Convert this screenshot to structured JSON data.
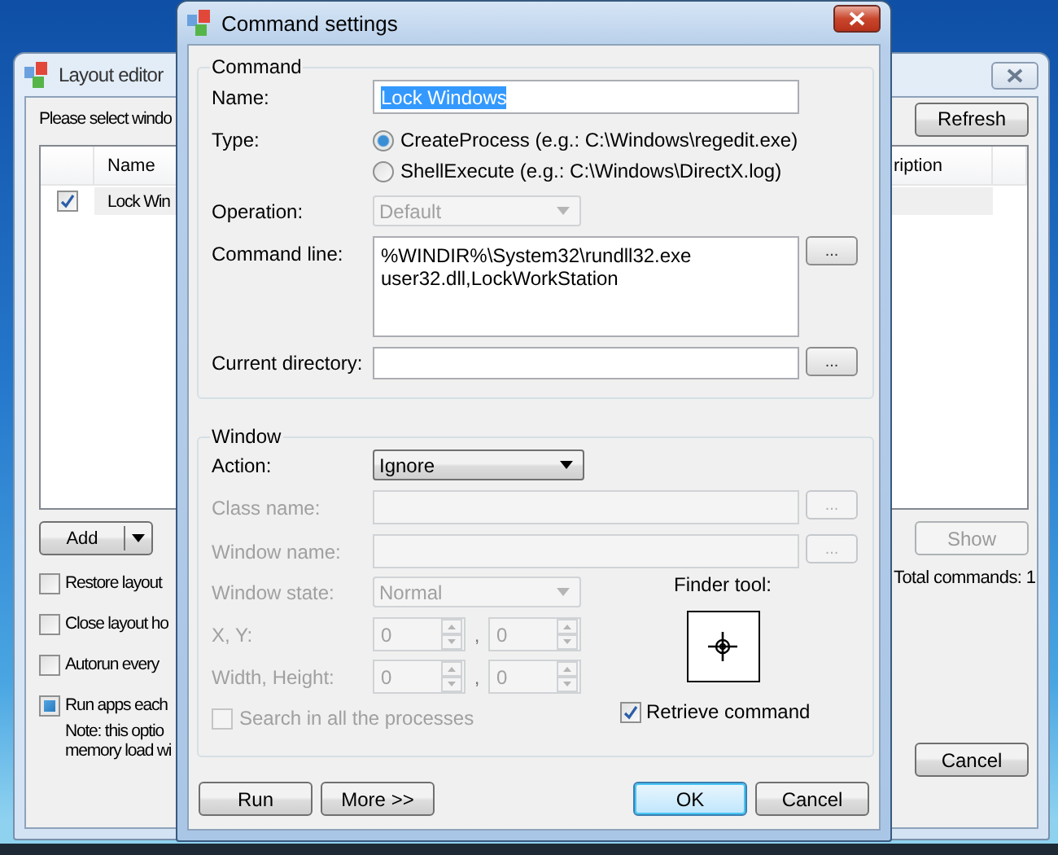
{
  "background_window": {
    "title": "Layout editor",
    "instruction": "Please select windo",
    "refresh_button": "Refresh",
    "list": {
      "columns": [
        "Name",
        "ription"
      ],
      "rows": [
        {
          "checked": true,
          "selected": true,
          "name": "Lock Win"
        }
      ]
    },
    "add_button": "Add",
    "show_button": {
      "label": "Show",
      "disabled": true
    },
    "total_commands": "Total commands: 1",
    "options": [
      {
        "label": "Restore layout",
        "checked": false
      },
      {
        "label": "Close layout ho",
        "checked": false
      },
      {
        "label": "Autorun every",
        "checked": false
      },
      {
        "label": "Run apps each",
        "checked": true
      }
    ],
    "note": [
      "Note: this optio",
      "memory load wi"
    ],
    "cancel_button": "Cancel"
  },
  "dialog": {
    "title": "Command settings",
    "command_group": {
      "title": "Command",
      "name": {
        "label": "Name:",
        "value": "Lock Windows"
      },
      "type": {
        "label": "Type:",
        "options": [
          {
            "label": "CreateProcess (e.g.: C:\\Windows\\regedit.exe)",
            "selected": true
          },
          {
            "label": "ShellExecute (e.g.: C:\\Windows\\DirectX.log)",
            "selected": false
          }
        ]
      },
      "operation": {
        "label": "Operation:",
        "value": "Default",
        "disabled": true
      },
      "command_line": {
        "label": "Command line:",
        "value": "%WINDIR%\\System32\\rundll32.exe user32.dll,LockWorkStation",
        "browse": "..."
      },
      "current_directory": {
        "label": "Current directory:",
        "browse": "..."
      }
    },
    "window_group": {
      "title": "Window",
      "action": {
        "label": "Action:",
        "value": "Ignore"
      },
      "class_name": {
        "label": "Class name:",
        "browse": "...",
        "disabled": true
      },
      "window_name": {
        "label": "Window name:",
        "browse": "...",
        "disabled": true
      },
      "window_state": {
        "label": "Window state:",
        "value": "Normal",
        "disabled": true
      },
      "position": {
        "label": "X, Y:",
        "values": [
          "0",
          "0"
        ],
        "separator": ",",
        "disabled": true
      },
      "size": {
        "label": "Width, Height:",
        "values": [
          "0",
          "0"
        ],
        "separator": ",",
        "disabled": true
      },
      "search_all": {
        "label": "Search in all the processes",
        "checked": false,
        "disabled": true
      },
      "finder_tool": {
        "label": "Finder tool:"
      },
      "retrieve_command": {
        "label": "Retrieve command",
        "checked": true
      }
    },
    "buttons": [
      {
        "label": "Run",
        "kind": "left",
        "default": false
      },
      {
        "label": "More >>",
        "kind": "left",
        "default": false
      },
      {
        "label": "OK",
        "kind": "right",
        "default": true
      },
      {
        "label": "Cancel",
        "kind": "right",
        "default": false
      }
    ]
  }
}
